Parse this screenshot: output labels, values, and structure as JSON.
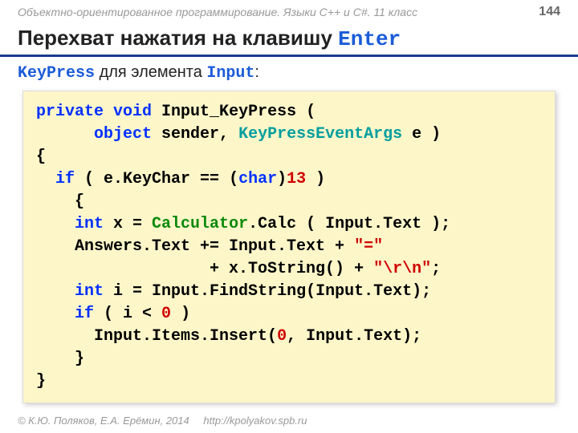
{
  "header": {
    "course": "Объектно-ориентированное программирование. Языки C++ и C#. 11 класс",
    "page_number": "144"
  },
  "title": {
    "prefix": "Перехват нажатия на клавишу ",
    "enter": "Enter"
  },
  "subtitle": {
    "keypress": "KeyPress",
    "mid": " для элемента ",
    "input": "Input",
    "colon": ":"
  },
  "code": {
    "l1a": "private",
    "l1b": " ",
    "l1c": "void",
    "l1d": " Input_KeyPress (",
    "l2a": "      ",
    "l2b": "object",
    "l2c": " sender, ",
    "l2d": "KeyPressEventArgs",
    "l2e": " e )",
    "l3": "{",
    "l4a": "  ",
    "l4b": "if",
    "l4c": " ( e.KeyChar == (",
    "l4d": "char",
    "l4e": ")",
    "l4f": "13",
    "l4g": " )",
    "l5": "    {",
    "l6a": "    ",
    "l6b": "int",
    "l6c": " x = ",
    "l6d": "Calculator",
    "l6e": ".Calc ( Input.Text );",
    "l7a": "    Answers.Text += Input.Text + ",
    "l7b": "\"=\"",
    "l8a": "                  + x.ToString() + ",
    "l8b": "\"\\r\\n\"",
    "l8c": ";",
    "l9a": "    ",
    "l9b": "int",
    "l9c": " i = Input.FindString(Input.Text);",
    "l10a": "    ",
    "l10b": "if",
    "l10c": " ( i < ",
    "l10d": "0",
    "l10e": " )",
    "l11a": "      Input.Items.Insert(",
    "l11b": "0",
    "l11c": ", Input.Text);",
    "l12": "    }",
    "l13": "}"
  },
  "footer": {
    "copyright": "© К.Ю. Поляков, Е.А. Ерёмин, 2014",
    "url": "http://kpolyakov.spb.ru"
  }
}
